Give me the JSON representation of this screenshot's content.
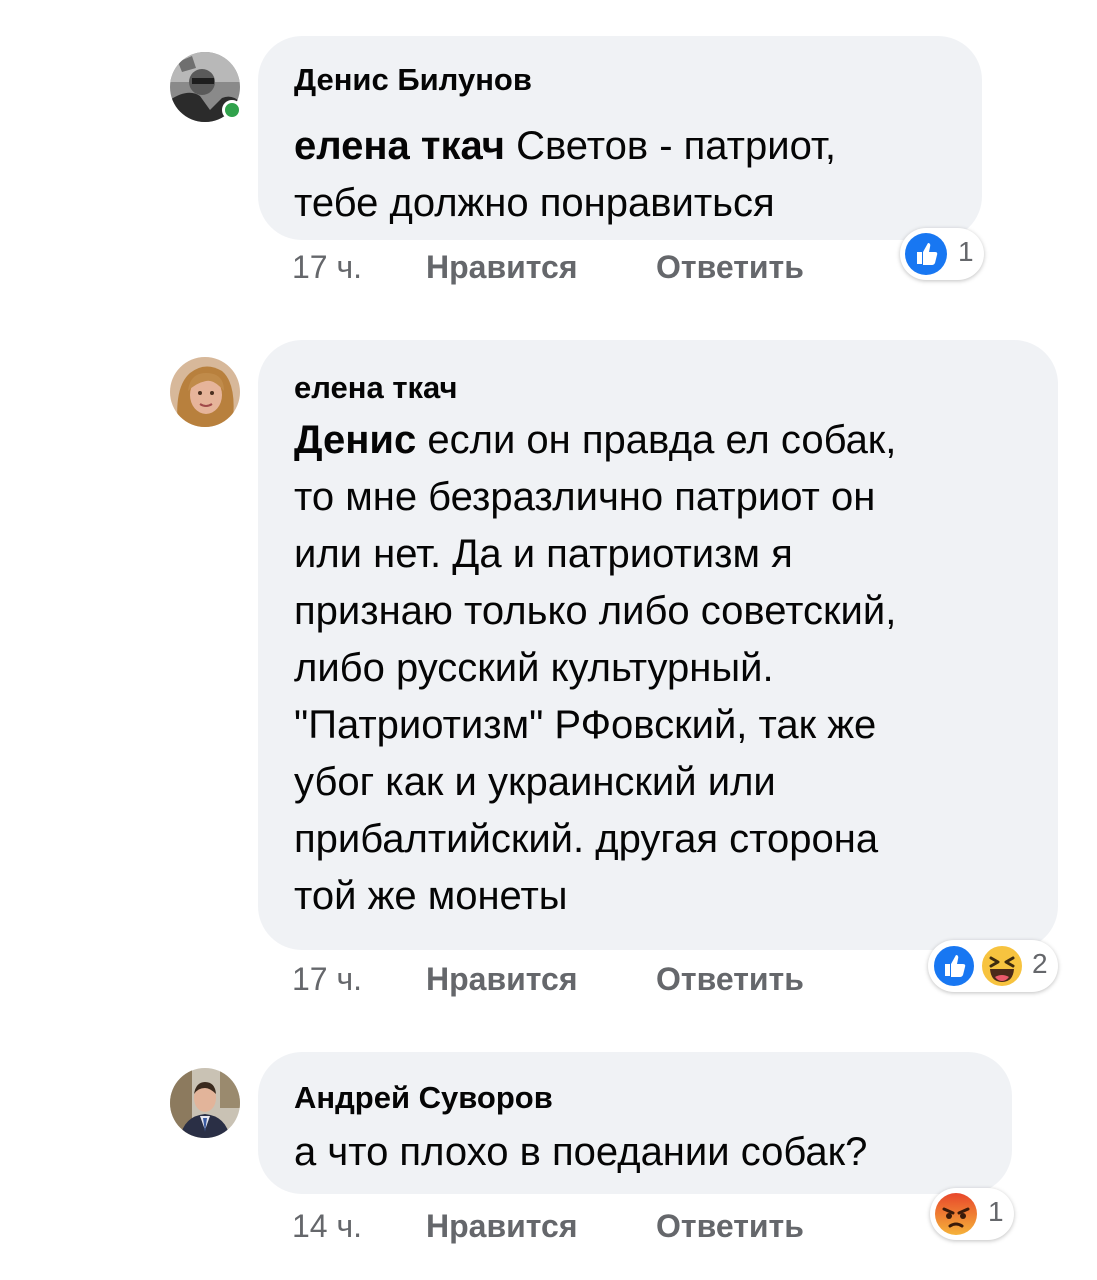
{
  "colors": {
    "bubble_bg": "#f0f2f5",
    "meta_text": "#65676b",
    "like_blue": "#1877f2",
    "online_green": "#31a24c"
  },
  "comments": [
    {
      "author": "Денис Билунов",
      "mention": "елена ткач",
      "lines": [
        "Светов - патриот,",
        "тебе должно понравиться"
      ],
      "time": "17 ч.",
      "like_label": "Нравится",
      "reply_label": "Ответить",
      "reactions": [
        "like-icon"
      ],
      "reaction_count": "1",
      "online": true
    },
    {
      "author": "елена ткач",
      "mention": "Денис",
      "lines": [
        "если он правда ел собак,",
        "то мне безразлично патриот он",
        "или нет. Да и патриотизм я",
        "признаю только либо советский,",
        "либо русский культурный.",
        "\"Патриотизм\" РФовский, так же",
        "убог как и украинский или",
        "прибалтийский. другая сторона",
        "той же монеты"
      ],
      "time": "17 ч.",
      "like_label": "Нравится",
      "reply_label": "Ответить",
      "reactions": [
        "like-icon",
        "haha-icon"
      ],
      "reaction_count": "2"
    },
    {
      "author": "Андрей Суворов",
      "lines": [
        "а что плохо в поедании собак?"
      ],
      "time": "14 ч.",
      "like_label": "Нравится",
      "reply_label": "Ответить",
      "reactions": [
        "angry-icon"
      ],
      "reaction_count": "1"
    }
  ]
}
